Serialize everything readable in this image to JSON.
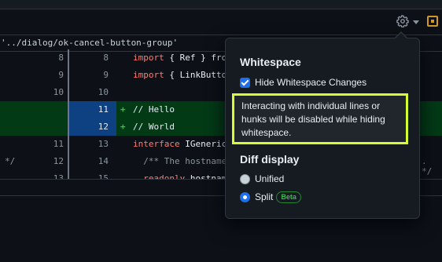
{
  "breadcrumb_path": "'../dialog/ok-cancel-button-group'",
  "diff_rows": [
    {
      "old": "8",
      "new": "8",
      "marker": "",
      "left": "",
      "right": "",
      "type": "ctx",
      "code_parts": [
        {
          "t": "kw",
          "v": "import"
        },
        {
          "t": "tx",
          "v": " { Ref } from"
        }
      ]
    },
    {
      "old": "9",
      "new": "9",
      "marker": "",
      "left": "",
      "right": "",
      "type": "ctx",
      "code_parts": [
        {
          "t": "kw",
          "v": "import"
        },
        {
          "t": "tx",
          "v": " { LinkButton"
        }
      ]
    },
    {
      "old": "10",
      "new": "10",
      "marker": "",
      "left": "",
      "right": "",
      "type": "ctx",
      "code_parts": []
    },
    {
      "old": "",
      "new": "11",
      "marker": "+",
      "left": "",
      "right": "",
      "type": "add",
      "code_parts": [
        {
          "t": "tx",
          "v": "// Hello"
        }
      ]
    },
    {
      "old": "",
      "new": "12",
      "marker": "+",
      "left": "",
      "right": "",
      "type": "add",
      "code_parts": [
        {
          "t": "tx",
          "v": "// World"
        }
      ]
    },
    {
      "old": "11",
      "new": "13",
      "marker": "",
      "left": "",
      "right": "",
      "type": "ctx",
      "code_parts": [
        {
          "t": "kw",
          "v": "interface"
        },
        {
          "t": "tx",
          "v": " IGenericG"
        }
      ]
    },
    {
      "old": "12",
      "new": "14",
      "marker": "",
      "left": "*/",
      "right": ". */",
      "type": "ctx",
      "code_parts": [
        {
          "t": "cm",
          "v": "  /** The hostname"
        }
      ]
    },
    {
      "old": "13",
      "new": "15",
      "marker": "",
      "left": "",
      "right": "",
      "type": "ctx",
      "code_parts": [
        {
          "t": "kw",
          "v": "  readonly"
        },
        {
          "t": "tx",
          "v": " hostname"
        }
      ]
    }
  ],
  "popover": {
    "whitespace_title": "Whitespace",
    "hide_whitespace_label": "Hide Whitespace Changes",
    "hide_whitespace_checked": true,
    "note": "Interacting with individual lines or hunks will be disabled while hiding whitespace.",
    "diff_display_title": "Diff display",
    "unified_label": "Unified",
    "split_label": "Split",
    "beta_badge": "Beta",
    "selected_mode": "Split"
  },
  "icons": {
    "settings": "gear-icon",
    "settings_caret": "chevron-down-icon",
    "panel": "panel-toggle-icon"
  },
  "colors": {
    "highlight_border": "#d4ff32",
    "accent": "#1f6feb",
    "added_bg": "#033a16",
    "beta_green": "#3fb950"
  }
}
